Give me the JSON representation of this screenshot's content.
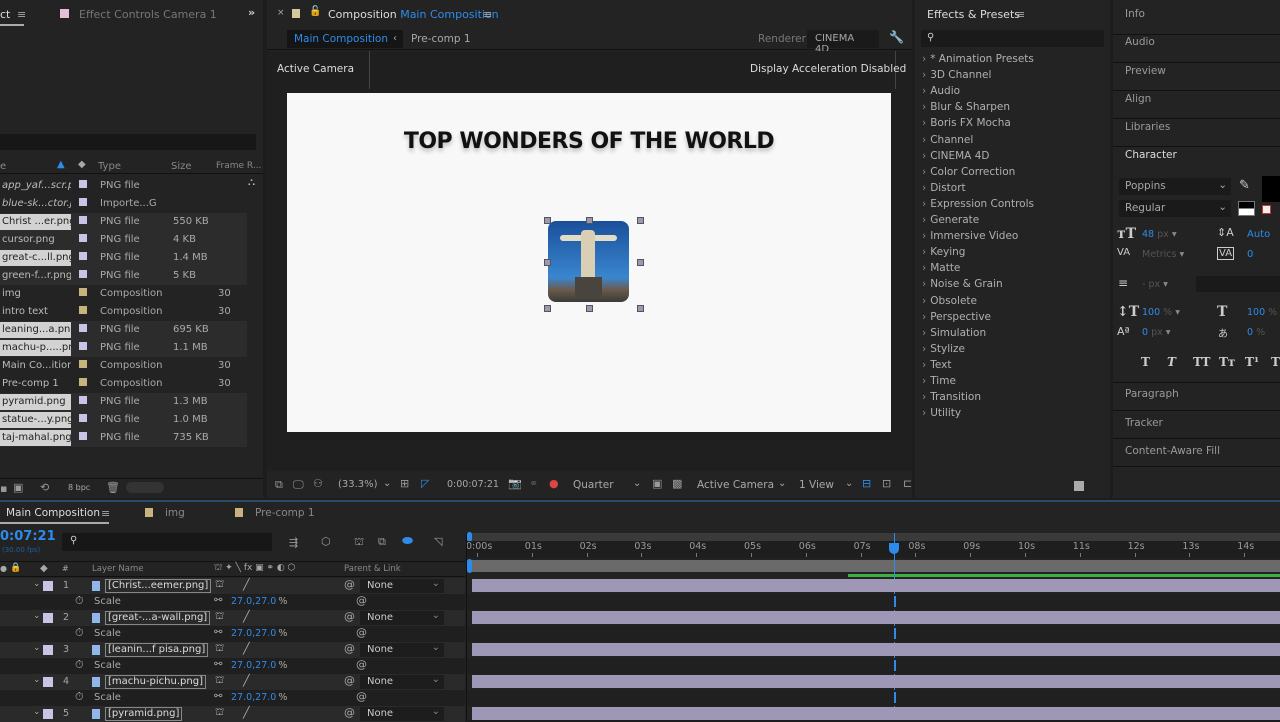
{
  "left_panel": {
    "tab_project_partial": "ct",
    "tab_effect_controls": "Effect Controls Camera 1",
    "overflow": "»",
    "columns": {
      "name": "e",
      "type": "Type",
      "size": "Size",
      "frame_rate": "Frame R..."
    },
    "items": [
      {
        "name": "app_yaf...scr.png",
        "type": "PNG file",
        "size": "",
        "fr": "",
        "color": "#c9c3e8",
        "selected": false,
        "italic": true
      },
      {
        "name": "blue-sk...ctor.jpg",
        "type": "Importe...G",
        "size": "",
        "fr": "",
        "color": "#c9c3e8",
        "selected": false,
        "italic": true
      },
      {
        "name": "Christ ...er.png",
        "type": "PNG file",
        "size": "550 KB",
        "fr": "",
        "color": "#c9c3e8",
        "selected": true
      },
      {
        "name": "cursor.png",
        "type": "PNG file",
        "size": "4 KB",
        "fr": "",
        "color": "#c9c3e8",
        "selected": false
      },
      {
        "name": "great-c...ll.png",
        "type": "PNG file",
        "size": "1.4 MB",
        "fr": "",
        "color": "#c9c3e8",
        "selected": true
      },
      {
        "name": "green-f...r.png",
        "type": "PNG file",
        "size": "5 KB",
        "fr": "",
        "color": "#c9c3e8",
        "selected": false
      },
      {
        "name": "img",
        "type": "Composition",
        "size": "",
        "fr": "30",
        "color": "#c8b37f",
        "selected": false
      },
      {
        "name": "intro text",
        "type": "Composition",
        "size": "",
        "fr": "30",
        "color": "#c8b37f",
        "selected": false
      },
      {
        "name": "leaning...a.png",
        "type": "PNG file",
        "size": "695 KB",
        "fr": "",
        "color": "#c9c3e8",
        "selected": true
      },
      {
        "name": "machu-p.....png",
        "type": "PNG file",
        "size": "1.1 MB",
        "fr": "",
        "color": "#c9c3e8",
        "selected": true
      },
      {
        "name": "Main Co...ition",
        "type": "Composition",
        "size": "",
        "fr": "30",
        "color": "#c8b37f",
        "selected": false
      },
      {
        "name": "Pre-comp 1",
        "type": "Composition",
        "size": "",
        "fr": "30",
        "color": "#c8b37f",
        "selected": false
      },
      {
        "name": "pyramid.png",
        "type": "PNG file",
        "size": "1.3 MB",
        "fr": "",
        "color": "#c9c3e8",
        "selected": true
      },
      {
        "name": "statue-...y.png",
        "type": "PNG file",
        "size": "1.0 MB",
        "fr": "",
        "color": "#c9c3e8",
        "selected": true
      },
      {
        "name": "taj-mahal.png",
        "type": "PNG file",
        "size": "735 KB",
        "fr": "",
        "color": "#c9c3e8",
        "selected": true
      }
    ],
    "bit_depth": "8 bpc"
  },
  "comp_panel": {
    "title_prefix": "Composition",
    "title_name": "Main Composition",
    "breadcrumbs": [
      "Main Composition",
      "Pre-comp 1"
    ],
    "renderer_label": "Renderer:",
    "renderer_value": "CINEMA 4D",
    "camera_label": "Active Camera",
    "accel_label": "Display Acceleration Disabled",
    "canvas_title": "TOP WONDERS OF THE WORLD",
    "toolbar": {
      "zoom": "(33.3%)",
      "timecode": "0:00:07:21",
      "resolution": "Quarter",
      "view_camera": "Active Camera",
      "views": "1 View"
    }
  },
  "effects_panel": {
    "title": "Effects & Presets",
    "items": [
      "* Animation Presets",
      "3D Channel",
      "Audio",
      "Blur & Sharpen",
      "Boris FX Mocha",
      "Channel",
      "CINEMA 4D",
      "Color Correction",
      "Distort",
      "Expression Controls",
      "Generate",
      "Immersive Video",
      "Keying",
      "Matte",
      "Noise & Grain",
      "Obsolete",
      "Perspective",
      "Simulation",
      "Stylize",
      "Text",
      "Time",
      "Transition",
      "Utility"
    ]
  },
  "right_panel": {
    "tabs_top": [
      "Info",
      "Audio",
      "Preview",
      "Align",
      "Libraries"
    ],
    "character": {
      "title": "Character",
      "font": "Poppins",
      "style": "Regular",
      "size": "48",
      "size_unit": "px",
      "leading": "Auto",
      "kerning": "Metrics",
      "tracking": "0",
      "stroke": "-",
      "stroke_unit": "px",
      "vscale": "100",
      "hscale": "100",
      "pct": "%",
      "baseline": "0",
      "baseline_unit": "px",
      "tsume": "0",
      "style_buttons": [
        "T",
        "T",
        "TT",
        "Tт",
        "T¹",
        "T₁"
      ]
    },
    "tabs_bottom": [
      "Paragraph",
      "Tracker",
      "Content-Aware Fill"
    ]
  },
  "timeline": {
    "tabs": [
      {
        "label": "Main Composition",
        "active": true
      },
      {
        "label": "img",
        "color": "#c8b37f"
      },
      {
        "label": "Pre-comp 1",
        "color": "#c8b37f"
      }
    ],
    "timecode": "0:07:21",
    "fps": "(30.00 fps)",
    "col_layer_name": "Layer Name",
    "col_parent": "Parent & Link",
    "col_num": "#",
    "ruler": [
      "0:00s",
      "01s",
      "02s",
      "03s",
      "04s",
      "05s",
      "06s",
      "07s",
      "08s",
      "09s",
      "10s",
      "11s",
      "12s",
      "13s",
      "14s"
    ],
    "playhead_seconds": 7.7,
    "layers": [
      {
        "num": "1",
        "name": "[Christ...eemer.png]",
        "parent": "None",
        "prop": "Scale",
        "value": "27.0,27.0",
        "unit": "%"
      },
      {
        "num": "2",
        "name": "[great-...a-wall.png]",
        "parent": "None",
        "prop": "Scale",
        "value": "27.0,27.0",
        "unit": "%"
      },
      {
        "num": "3",
        "name": "[leanin...f pisa.png]",
        "parent": "None",
        "prop": "Scale",
        "value": "27.0,27.0",
        "unit": "%"
      },
      {
        "num": "4",
        "name": "[machu-pichu.png]",
        "parent": "None",
        "prop": "Scale",
        "value": "27.0,27.0",
        "unit": "%"
      },
      {
        "num": "5",
        "name": "[pyramid.png]",
        "parent": "None"
      }
    ],
    "layer_color": "#c9c3e8"
  },
  "colors": {
    "accent": "#2d8ceb",
    "bar": "#9f97b6",
    "green": "#3cb043"
  }
}
